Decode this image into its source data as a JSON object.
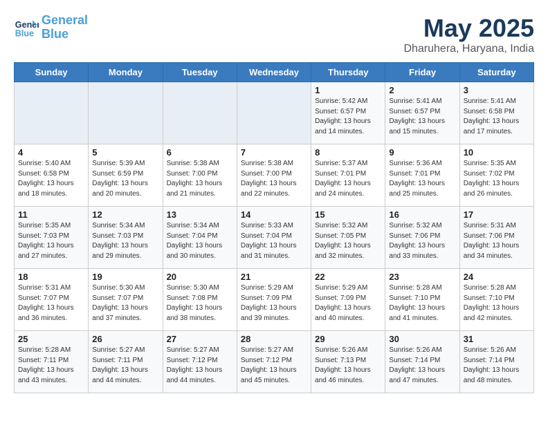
{
  "logo": {
    "line1": "General",
    "line2": "Blue"
  },
  "title": "May 2025",
  "location": "Dharuhera, Haryana, India",
  "days_header": [
    "Sunday",
    "Monday",
    "Tuesday",
    "Wednesday",
    "Thursday",
    "Friday",
    "Saturday"
  ],
  "rows": [
    [
      {
        "num": "",
        "info": ""
      },
      {
        "num": "",
        "info": ""
      },
      {
        "num": "",
        "info": ""
      },
      {
        "num": "",
        "info": ""
      },
      {
        "num": "1",
        "info": "Sunrise: 5:42 AM\nSunset: 6:57 PM\nDaylight: 13 hours\nand 14 minutes."
      },
      {
        "num": "2",
        "info": "Sunrise: 5:41 AM\nSunset: 6:57 PM\nDaylight: 13 hours\nand 15 minutes."
      },
      {
        "num": "3",
        "info": "Sunrise: 5:41 AM\nSunset: 6:58 PM\nDaylight: 13 hours\nand 17 minutes."
      }
    ],
    [
      {
        "num": "4",
        "info": "Sunrise: 5:40 AM\nSunset: 6:58 PM\nDaylight: 13 hours\nand 18 minutes."
      },
      {
        "num": "5",
        "info": "Sunrise: 5:39 AM\nSunset: 6:59 PM\nDaylight: 13 hours\nand 20 minutes."
      },
      {
        "num": "6",
        "info": "Sunrise: 5:38 AM\nSunset: 7:00 PM\nDaylight: 13 hours\nand 21 minutes."
      },
      {
        "num": "7",
        "info": "Sunrise: 5:38 AM\nSunset: 7:00 PM\nDaylight: 13 hours\nand 22 minutes."
      },
      {
        "num": "8",
        "info": "Sunrise: 5:37 AM\nSunset: 7:01 PM\nDaylight: 13 hours\nand 24 minutes."
      },
      {
        "num": "9",
        "info": "Sunrise: 5:36 AM\nSunset: 7:01 PM\nDaylight: 13 hours\nand 25 minutes."
      },
      {
        "num": "10",
        "info": "Sunrise: 5:35 AM\nSunset: 7:02 PM\nDaylight: 13 hours\nand 26 minutes."
      }
    ],
    [
      {
        "num": "11",
        "info": "Sunrise: 5:35 AM\nSunset: 7:03 PM\nDaylight: 13 hours\nand 27 minutes."
      },
      {
        "num": "12",
        "info": "Sunrise: 5:34 AM\nSunset: 7:03 PM\nDaylight: 13 hours\nand 29 minutes."
      },
      {
        "num": "13",
        "info": "Sunrise: 5:34 AM\nSunset: 7:04 PM\nDaylight: 13 hours\nand 30 minutes."
      },
      {
        "num": "14",
        "info": "Sunrise: 5:33 AM\nSunset: 7:04 PM\nDaylight: 13 hours\nand 31 minutes."
      },
      {
        "num": "15",
        "info": "Sunrise: 5:32 AM\nSunset: 7:05 PM\nDaylight: 13 hours\nand 32 minutes."
      },
      {
        "num": "16",
        "info": "Sunrise: 5:32 AM\nSunset: 7:06 PM\nDaylight: 13 hours\nand 33 minutes."
      },
      {
        "num": "17",
        "info": "Sunrise: 5:31 AM\nSunset: 7:06 PM\nDaylight: 13 hours\nand 34 minutes."
      }
    ],
    [
      {
        "num": "18",
        "info": "Sunrise: 5:31 AM\nSunset: 7:07 PM\nDaylight: 13 hours\nand 36 minutes."
      },
      {
        "num": "19",
        "info": "Sunrise: 5:30 AM\nSunset: 7:07 PM\nDaylight: 13 hours\nand 37 minutes."
      },
      {
        "num": "20",
        "info": "Sunrise: 5:30 AM\nSunset: 7:08 PM\nDaylight: 13 hours\nand 38 minutes."
      },
      {
        "num": "21",
        "info": "Sunrise: 5:29 AM\nSunset: 7:09 PM\nDaylight: 13 hours\nand 39 minutes."
      },
      {
        "num": "22",
        "info": "Sunrise: 5:29 AM\nSunset: 7:09 PM\nDaylight: 13 hours\nand 40 minutes."
      },
      {
        "num": "23",
        "info": "Sunrise: 5:28 AM\nSunset: 7:10 PM\nDaylight: 13 hours\nand 41 minutes."
      },
      {
        "num": "24",
        "info": "Sunrise: 5:28 AM\nSunset: 7:10 PM\nDaylight: 13 hours\nand 42 minutes."
      }
    ],
    [
      {
        "num": "25",
        "info": "Sunrise: 5:28 AM\nSunset: 7:11 PM\nDaylight: 13 hours\nand 43 minutes."
      },
      {
        "num": "26",
        "info": "Sunrise: 5:27 AM\nSunset: 7:11 PM\nDaylight: 13 hours\nand 44 minutes."
      },
      {
        "num": "27",
        "info": "Sunrise: 5:27 AM\nSunset: 7:12 PM\nDaylight: 13 hours\nand 44 minutes."
      },
      {
        "num": "28",
        "info": "Sunrise: 5:27 AM\nSunset: 7:12 PM\nDaylight: 13 hours\nand 45 minutes."
      },
      {
        "num": "29",
        "info": "Sunrise: 5:26 AM\nSunset: 7:13 PM\nDaylight: 13 hours\nand 46 minutes."
      },
      {
        "num": "30",
        "info": "Sunrise: 5:26 AM\nSunset: 7:14 PM\nDaylight: 13 hours\nand 47 minutes."
      },
      {
        "num": "31",
        "info": "Sunrise: 5:26 AM\nSunset: 7:14 PM\nDaylight: 13 hours\nand 48 minutes."
      }
    ]
  ]
}
